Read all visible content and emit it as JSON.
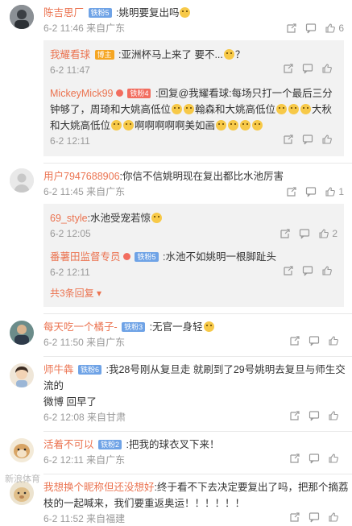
{
  "comments": [
    {
      "name": "陈吉思厂",
      "badge": "铁粉5",
      "text": ":姚明要复出吗",
      "meta": "6-2 11:46 来自广东",
      "likes": "6",
      "replies": [
        {
          "name": "我耀看球",
          "badge": "博主",
          "text": ":亚洲杯马上来了 要不...",
          "tail": "？",
          "meta": "6-2 11:47",
          "likes": ""
        },
        {
          "name": "MickeyMick99",
          "badge": "铁粉4",
          "text_1": ":回复@我耀看球:每场只打一个最后三分钟够了，周琦和大姚高低位",
          "text_2": "翰森和大姚高低位",
          "text_3": "大秋和大姚高低位",
          "text_4": "啊啊啊啊啊美如画",
          "meta": "6-2 12:11",
          "likes": ""
        }
      ]
    },
    {
      "name": "用户7947688906",
      "text": ":你信不信姚明现在复出都比水池厉害",
      "meta": "6-2 11:45 来自广东",
      "likes": "1",
      "replies": [
        {
          "name": "69_style",
          "text": ":水池受宠若惊",
          "meta": "6-2 12:05",
          "likes": "2"
        },
        {
          "name": "番薯田监督专员",
          "badge": "铁粉5",
          "text": ":水池不如姚明一根脚趾头",
          "meta": "6-2 12:11",
          "likes": ""
        }
      ],
      "more": "共3条回复"
    },
    {
      "name": "每天吃一个橘子-",
      "badge": "铁粉3",
      "text": ":无官一身轻",
      "meta": "6-2 11:50 来自广东",
      "likes": ""
    },
    {
      "name": "师牛犇",
      "badge": "铁粉6",
      "text_1": ":我28号刚从复旦走 就刷到了29号姚明去复旦与师生交流的",
      "text_2": "微博 回早了",
      "meta": "6-2 12:08 来自甘肃",
      "likes": ""
    },
    {
      "name": "活着不可以",
      "badge": "铁粉2",
      "text": ":把我的球衣叉下来！",
      "meta": "6-2 12:11 来自广东",
      "likes": ""
    },
    {
      "name": "我想换个昵称但还没想好",
      "text_1": ":终于看不下去决定要复出了吗，把那个摘荔",
      "text_2": "枝的一起喊来，我们要重返奥运！！！！！！",
      "meta": "6-2 11:52 来自福建",
      "likes": ""
    }
  ],
  "watermark": "新浪体育"
}
